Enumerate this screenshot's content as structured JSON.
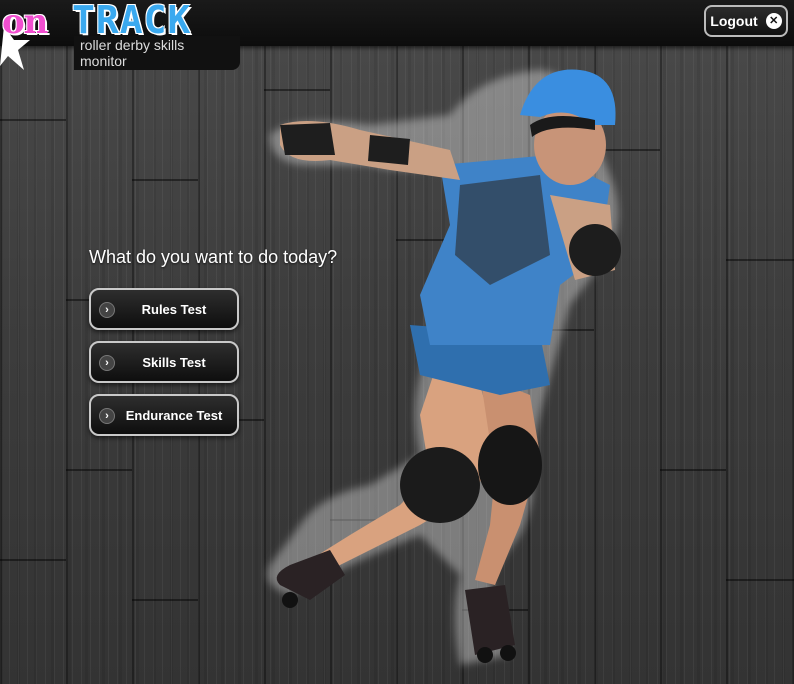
{
  "header": {
    "logo_on": "on",
    "logo_track": "TRACK",
    "logo_subtitle": "roller derby skills monitor",
    "logout_label": "Logout",
    "logout_icon": "close-icon"
  },
  "main": {
    "prompt": "What do you want to do today?",
    "menu": [
      {
        "label": "Rules Test",
        "icon": "chevron-right-icon"
      },
      {
        "label": "Skills Test",
        "icon": "chevron-right-icon"
      },
      {
        "label": "Endurance Test",
        "icon": "chevron-right-icon"
      }
    ]
  },
  "colors": {
    "logo_pink": "#f24fd0",
    "logo_blue": "#3aa9ef",
    "header_bg": "#0c0c0c",
    "button_border": "#c9c9c9"
  }
}
